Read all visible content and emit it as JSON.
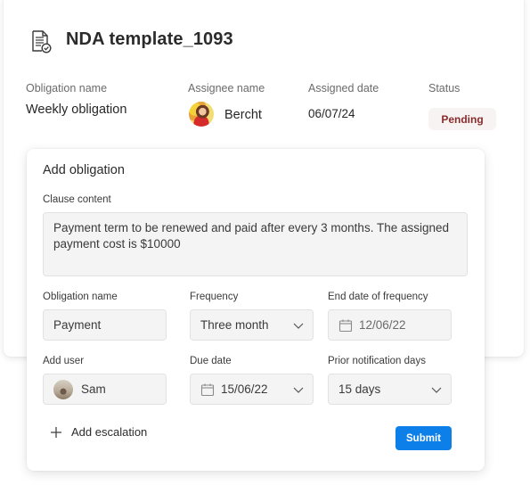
{
  "header": {
    "title": "NDA template_1093",
    "icon": "document-check-icon"
  },
  "summary": {
    "obligation_name_label": "Obligation name",
    "obligation_name_value": "Weekly obligation",
    "assignee_label": "Assignee name",
    "assignee_value": "Bercht",
    "assigned_date_label": "Assigned date",
    "assigned_date_value": "06/07/24",
    "status_label": "Status",
    "status_value": "Pending",
    "status_color": "#8b2c2c"
  },
  "dialog": {
    "title": "Add obligation",
    "clause_label": "Clause content",
    "clause_value": "Payment term to be renewed and paid after every 3 months. The assigned payment cost is $10000",
    "obligation_name_label": "Obligation name",
    "obligation_name_value": "Payment",
    "frequency_label": "Frequency",
    "frequency_value": "Three month",
    "end_date_label": "End date of frequency",
    "end_date_value": "12/06/22",
    "add_user_label": "Add user",
    "add_user_value": "Sam",
    "due_date_label": "Due date",
    "due_date_value": "15/06/22",
    "prior_notification_label": "Prior notification days",
    "prior_notification_value": "15 days",
    "add_escalation_label": "Add escalation",
    "submit_label": "Submit",
    "accent_color": "#0d7fe8"
  }
}
